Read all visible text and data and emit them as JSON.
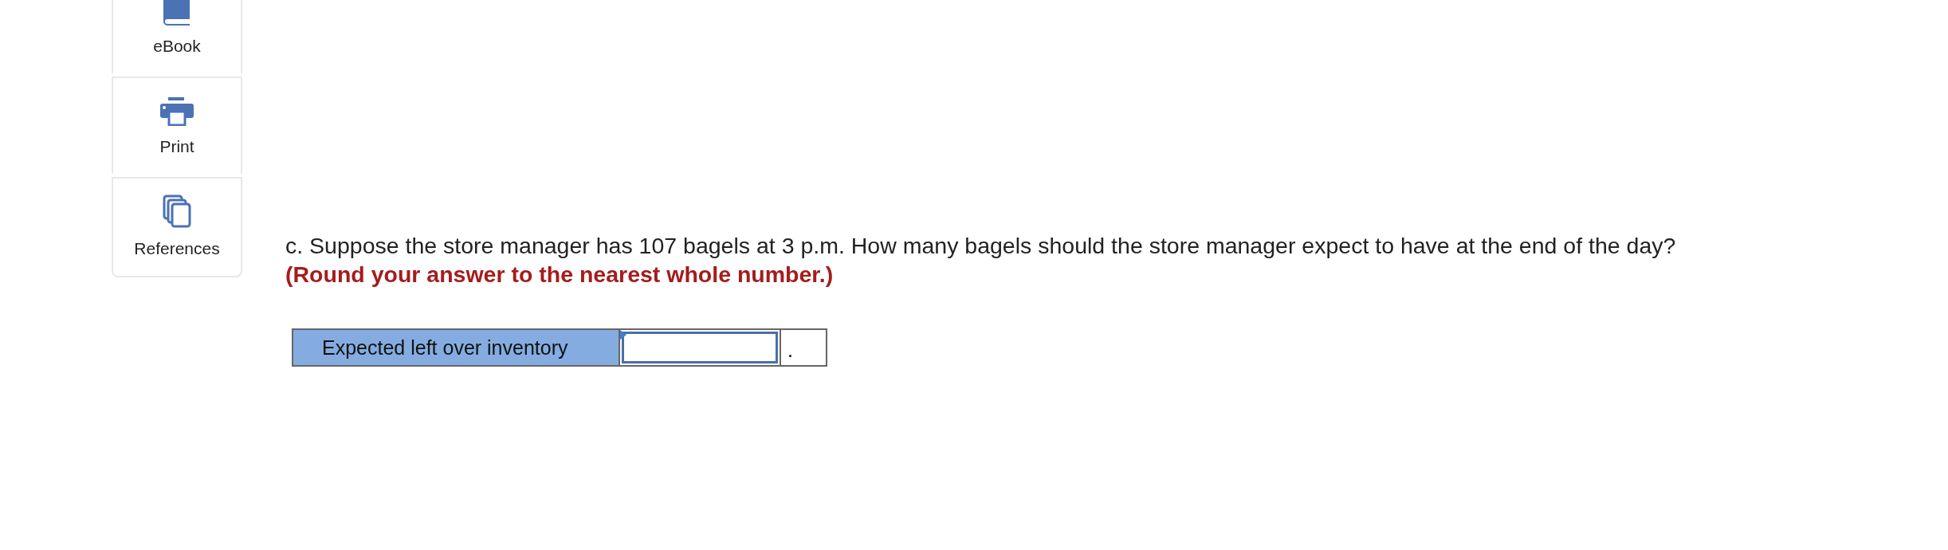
{
  "sidebar": {
    "items": [
      {
        "label": "eBook",
        "kind": "book"
      },
      {
        "label": "Print",
        "kind": "printer"
      },
      {
        "label": "References",
        "kind": "pages"
      }
    ]
  },
  "question": {
    "text": "c. Suppose the store manager has 107 bagels at 3 p.m. How many bagels should the store manager expect to have at the end of the day? **(Round your answer to the nearest whole number.)**"
  },
  "answer_table": {
    "label": "Expected left over inventory",
    "unit": "."
  }
}
